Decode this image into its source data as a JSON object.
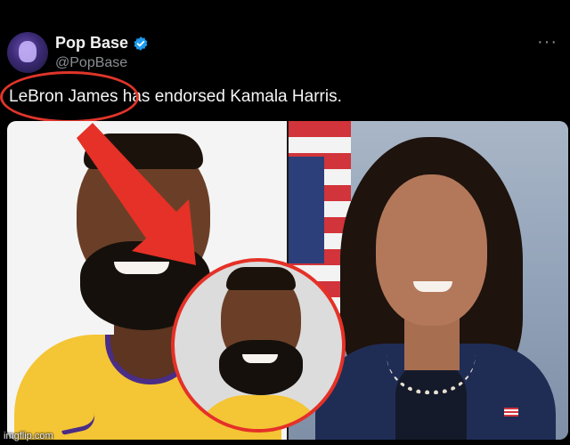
{
  "author": {
    "name": "Pop Base",
    "handle": "@PopBase",
    "verified": true,
    "verified_color": "#1d9bf0"
  },
  "tweet": {
    "text": "LeBron James has endorsed Kamala Harris."
  },
  "menu": {
    "icon": "more-options-icon",
    "label": "···"
  },
  "annotation": {
    "color": "#e53127"
  },
  "watermark": "imgflip.com"
}
